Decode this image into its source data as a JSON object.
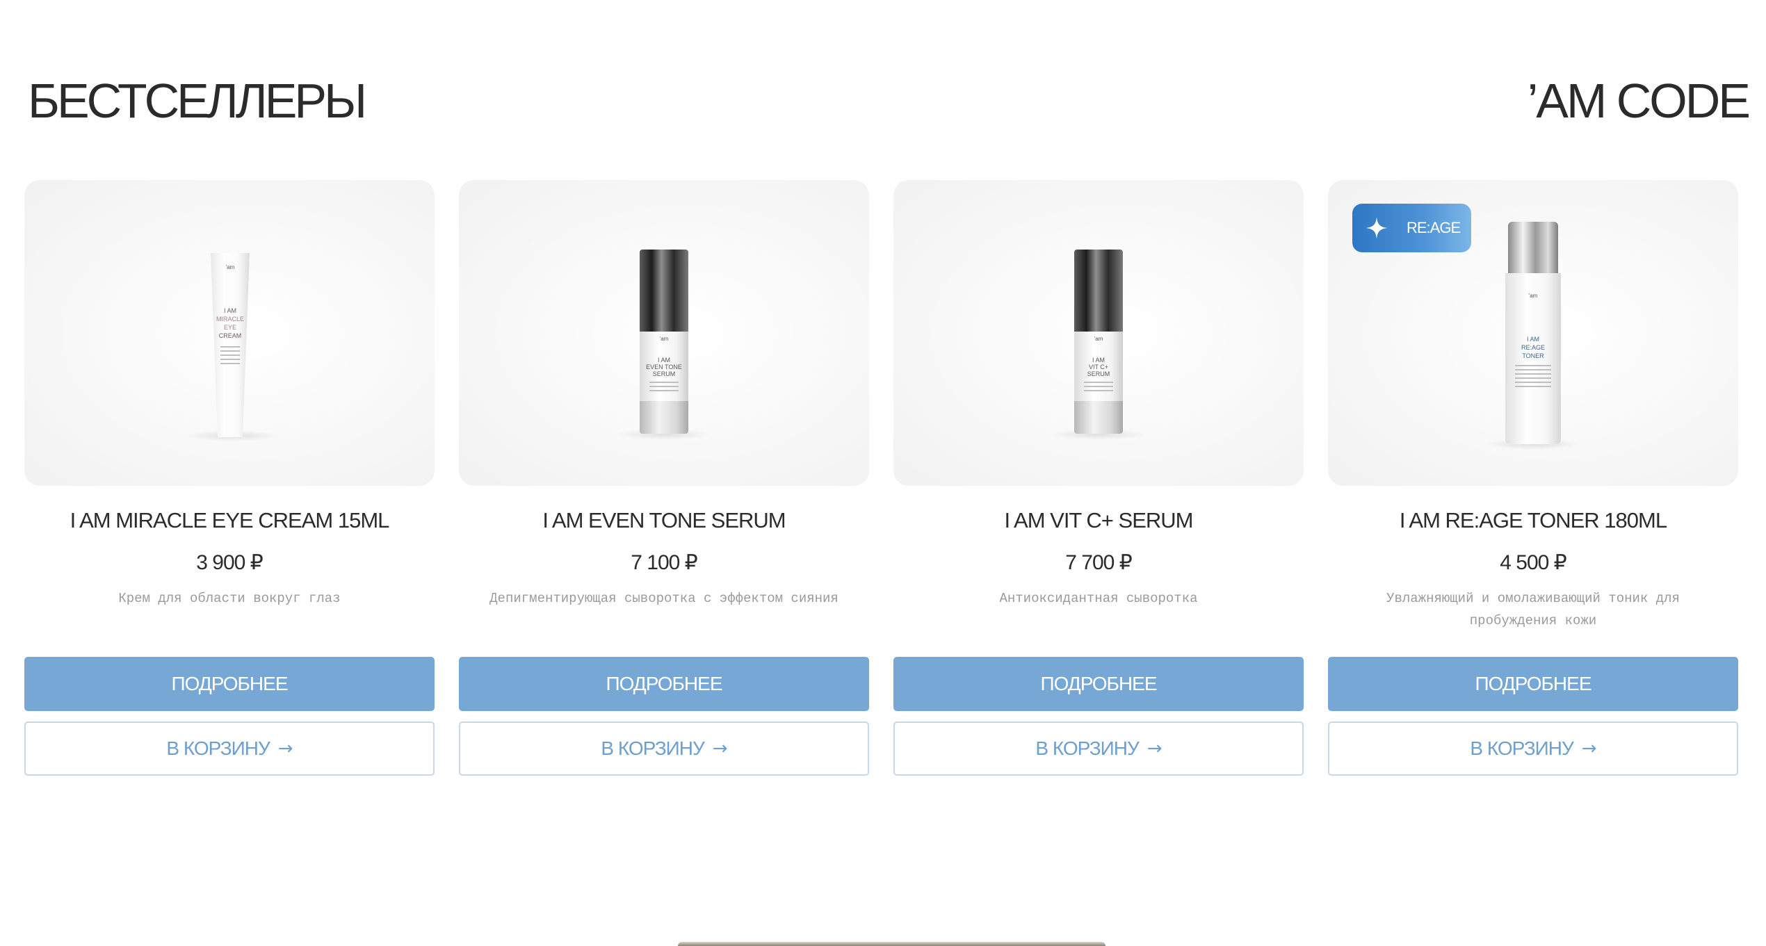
{
  "header": {
    "title": "БЕСТСЕЛЛЕРЫ",
    "brand": "’AM CODE"
  },
  "colors": {
    "primary_button": "#76a7d5",
    "cart_text": "#6ea0cf",
    "badge": "#3d86cf"
  },
  "products": [
    {
      "name": "I AM MIRACLE EYE CREAM 15ML",
      "price": "3 900 ₽",
      "description": "Крем для области вокруг глаз",
      "details_label": "ПОДРОБНЕЕ",
      "cart_label": "В КОРЗИНУ",
      "cart_icon": "arrow-right-icon",
      "image": {
        "kind": "tube",
        "brand": "'am",
        "label_lines": [
          "I AM",
          "MIRACLE",
          "EYE",
          "CREAM"
        ]
      }
    },
    {
      "name": "I AM EVEN TONE SERUM",
      "price": "7 100 ₽",
      "description": "Депигментирующая сыворотка с эффектом сияния",
      "details_label": "ПОДРОБНЕЕ",
      "cart_label": "В КОРЗИНУ",
      "cart_icon": "arrow-right-icon",
      "image": {
        "kind": "serum",
        "brand": "'am",
        "label_lines": [
          "I AM",
          "EVEN TONE",
          "SERUM"
        ]
      }
    },
    {
      "name": "I AM VIT C+ SERUM",
      "price": "7 700 ₽",
      "description": "Антиоксидантная сыворотка",
      "details_label": "ПОДРОБНЕЕ",
      "cart_label": "В КОРЗИНУ",
      "cart_icon": "arrow-right-icon",
      "image": {
        "kind": "serum",
        "brand": "'am",
        "label_lines": [
          "I AM",
          "VIT C+",
          "SERUM"
        ]
      }
    },
    {
      "name": "I AM RE:AGE TONER 180ML",
      "price": "4 500 ₽",
      "description": "Увлажняющий и омолаживающий тоник для пробуждения кожи",
      "details_label": "ПОДРОБНЕЕ",
      "cart_label": "В КОРЗИНУ",
      "cart_icon": "arrow-right-icon",
      "badge": {
        "label": "RE:AGE",
        "icon": "sparkle-icon"
      },
      "image": {
        "kind": "toner",
        "brand": "'am",
        "label_lines": [
          "I AM",
          "RE:AGE",
          "TONER"
        ]
      }
    }
  ]
}
